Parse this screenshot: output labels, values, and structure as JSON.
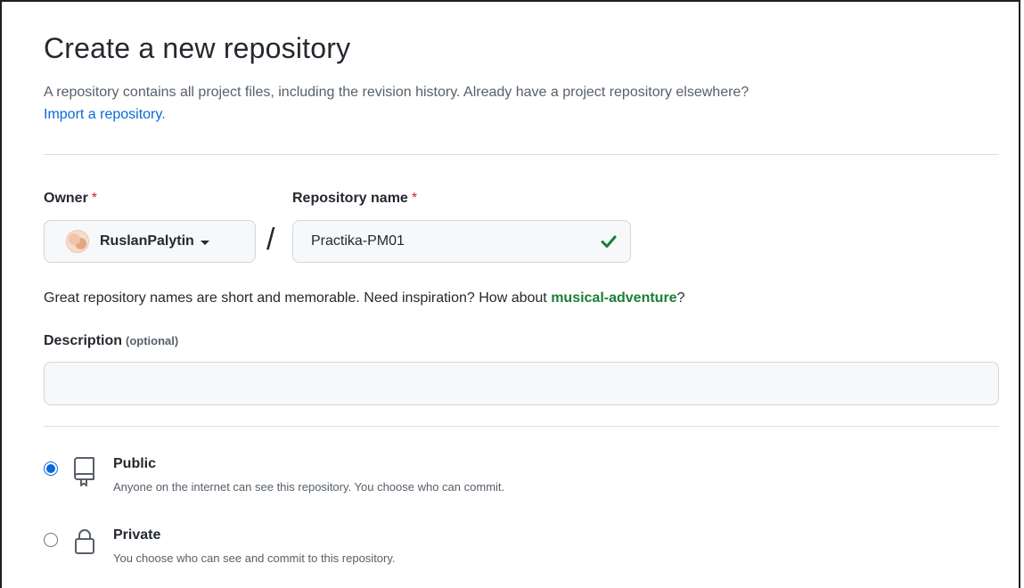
{
  "page": {
    "title": "Create a new repository",
    "subtitle": "A repository contains all project files, including the revision history. Already have a project repository elsewhere?",
    "import_link": "Import a repository."
  },
  "owner": {
    "label": "Owner",
    "required_mark": "*",
    "selected": "RuslanPalytin",
    "avatar_icon": "avatar",
    "dropdown_icon": "caret-down-icon"
  },
  "separator": "/",
  "repository_name": {
    "label": "Repository name",
    "required_mark": "*",
    "value": "Practika-PM01",
    "valid_icon": "check-icon",
    "valid_color": "#1a7f37"
  },
  "hint": {
    "text": "Great repository names are short and memorable. Need inspiration? How about ",
    "suggestion": "musical-adventure",
    "end": "?"
  },
  "description": {
    "label": "Description",
    "optional": "(optional)",
    "value": ""
  },
  "visibility": [
    {
      "title": "Public",
      "description": "Anyone on the internet can see this repository. You choose who can commit.",
      "selected": true,
      "icon": "repo-icon"
    },
    {
      "title": "Private",
      "description": "You choose who can see and commit to this repository.",
      "selected": false,
      "icon": "lock-icon"
    }
  ],
  "colors": {
    "accent": "#0969da",
    "required": "#cf222e",
    "suggestion": "#1a7f37",
    "muted": "#57606a"
  }
}
